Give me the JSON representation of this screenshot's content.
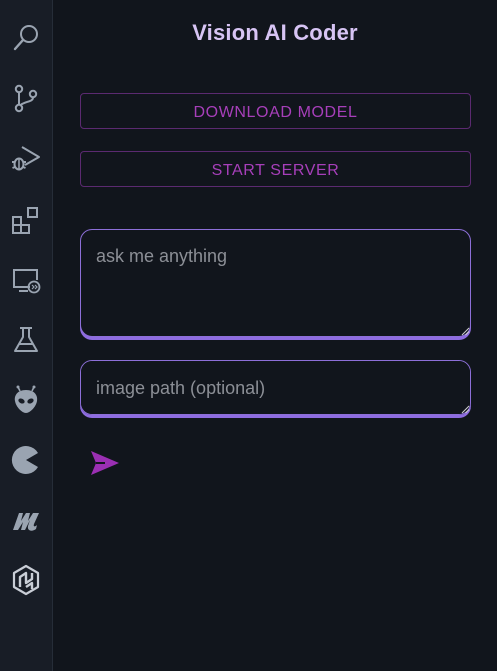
{
  "activity_bar": {
    "items": [
      {
        "name": "search-icon"
      },
      {
        "name": "source-control-icon"
      },
      {
        "name": "run-debug-icon"
      },
      {
        "name": "extensions-icon"
      },
      {
        "name": "remote-explorer-icon"
      },
      {
        "name": "testing-flask-icon"
      },
      {
        "name": "alien-extension-icon"
      },
      {
        "name": "pie-extension-icon"
      },
      {
        "name": "m-logo-extension-icon"
      },
      {
        "name": "hex-logo-extension-icon"
      }
    ]
  },
  "panel": {
    "title": "Vision AI Coder",
    "download_label": "DOWNLOAD MODEL",
    "server_label": "START SERVER",
    "prompt_placeholder": "ask me anything",
    "image_placeholder": "image path (optional)",
    "send_icon": "send-icon"
  },
  "colors": {
    "background": "#11151c",
    "activity_bar": "#181d26",
    "title": "#d7c4f4",
    "button_text": "#a73fba",
    "button_border": "#5b2a70",
    "field_border": "#8d6fd8",
    "send_icon": "#9b2fb3",
    "icon": "#9aa4b1"
  }
}
